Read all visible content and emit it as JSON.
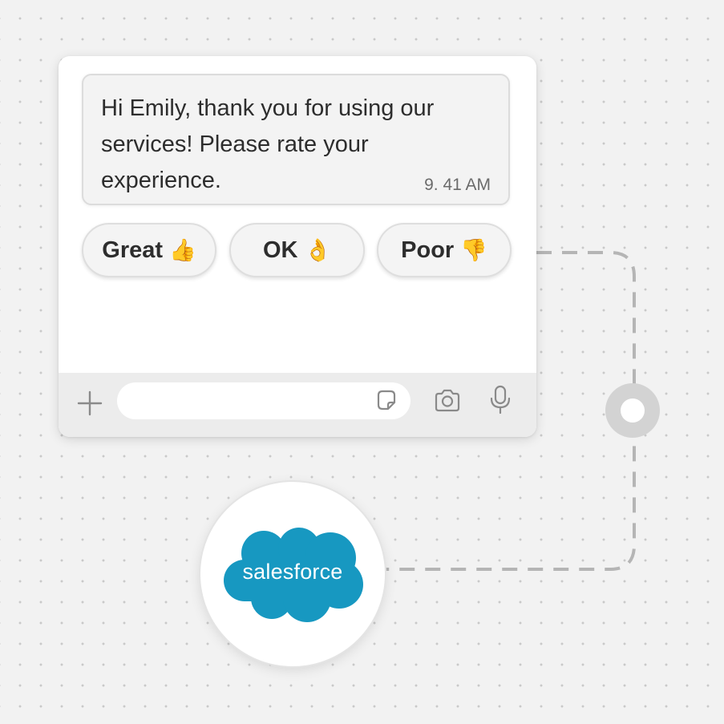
{
  "chat": {
    "message": {
      "text": "Hi Emily, thank you for using our services! Please rate your experience.",
      "time": "9. 41 AM"
    },
    "quick_replies": [
      {
        "label": "Great",
        "emoji": "👍"
      },
      {
        "label": "OK",
        "emoji": "👌"
      },
      {
        "label": "Poor",
        "emoji": "👎"
      }
    ],
    "composer": {
      "value": "",
      "placeholder": "",
      "icons": [
        "plus-icon",
        "sticker-icon",
        "camera-icon",
        "microphone-icon"
      ]
    }
  },
  "integration": {
    "logo_text": "salesforce",
    "colors": {
      "brand": "#1798c1",
      "connector": "#b5b5b5",
      "node": "#d3d3d3"
    }
  }
}
